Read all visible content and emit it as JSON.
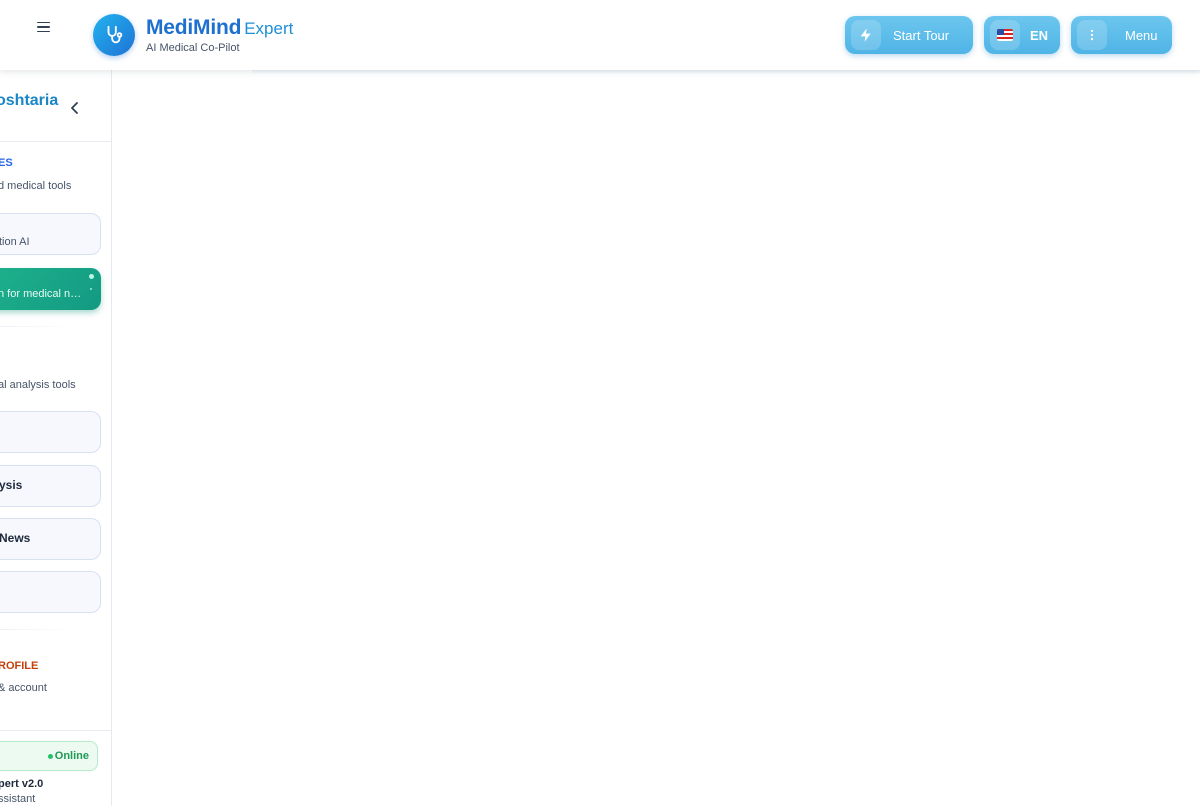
{
  "header": {
    "brand_name": "MediMind",
    "brand_suffix": "Expert",
    "tagline": "AI Medical Co-Pilot",
    "start_tour_label": "Start Tour",
    "language_label": "EN",
    "menu_label": "Menu"
  },
  "sidebar": {
    "user_name_fragment": "oshtaria",
    "sections": [
      {
        "title": "ES",
        "description": "d medical tools",
        "color": "#2563eb",
        "items": [
          {
            "title": "",
            "subtitle": "tion AI",
            "active": false
          },
          {
            "title": "",
            "subtitle": "n for medical notes",
            "active": true
          }
        ]
      },
      {
        "title": "",
        "description": "al analysis tools",
        "color": "#1e293b",
        "items": [
          {
            "title": "",
            "subtitle": ""
          },
          {
            "title": "ysis",
            "subtitle": ""
          },
          {
            "title": "News",
            "subtitle": ""
          },
          {
            "title": "",
            "subtitle": ""
          }
        ]
      },
      {
        "title": "ROFILE",
        "description": "& account",
        "color": "#c2410c"
      }
    ],
    "status": "Online",
    "version": "pert v2.0",
    "version_sub": "ssistant"
  },
  "colors": {
    "brand": "#1d6fd0",
    "header_buttons": "#5cbbe9",
    "active_item": "#17a888",
    "online": "#1f9a55"
  },
  "icons": {
    "menu": "hamburger-icon",
    "logo": "stethoscope-icon",
    "tour": "lightning-icon",
    "language": "us-flag-icon",
    "more": "vertical-dots-icon",
    "collapse": "chevron-left-icon"
  }
}
